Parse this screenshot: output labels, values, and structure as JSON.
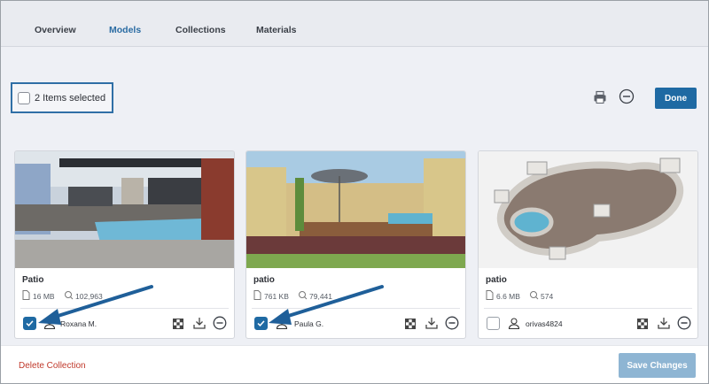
{
  "tabs": [
    {
      "label": "Overview"
    },
    {
      "label": "Models"
    },
    {
      "label": "Collections"
    },
    {
      "label": "Materials"
    }
  ],
  "selection": {
    "label": "2 Items selected"
  },
  "toolbar": {
    "done_label": "Done"
  },
  "cards": [
    {
      "title": "Patio",
      "size": "16 MB",
      "views": "102,963",
      "owner": "Roxana M.",
      "selected": true
    },
    {
      "title": "patio",
      "size": "761 KB",
      "views": "79,441",
      "owner": "Paula G.",
      "selected": true
    },
    {
      "title": "patio",
      "size": "6.6 MB",
      "views": "574",
      "owner": "orivas4824",
      "selected": false
    }
  ],
  "footer": {
    "delete_label": "Delete Collection",
    "save_label": "Save Changes"
  },
  "colors": {
    "accent": "#1f6aa3",
    "danger": "#c0392b",
    "save_disabled": "#8eb5d3"
  }
}
